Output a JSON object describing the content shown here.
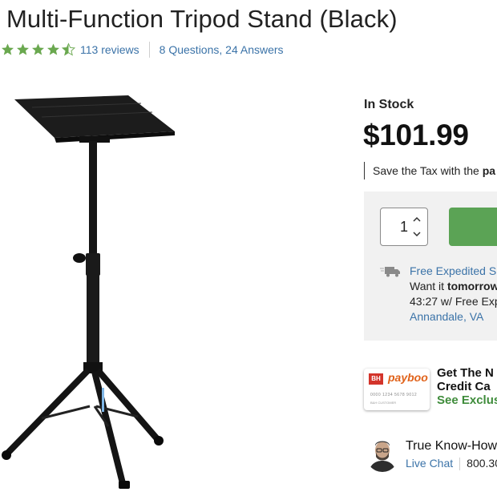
{
  "product": {
    "title": "Multi-Function Tripod Stand (Black)",
    "rating_stars": 4.5,
    "reviews_link": "113 reviews",
    "qa_link": "8 Questions, 24 Answers",
    "image_icon": "tripod-stand-image"
  },
  "purchase": {
    "stock_status": "In Stock",
    "price": "$101.99",
    "tax_text": "Save the Tax with the",
    "tax_brand": "pa",
    "quantity": "1",
    "add_to_cart_color": "#5ba355"
  },
  "shipping": {
    "free_expedited": "Free Expedited S",
    "want_it_prefix": "Want it ",
    "want_it_day": "tomorrow",
    "timer_line": "43:27 w/ Free Exp",
    "location": "Annandale, VA"
  },
  "payboo": {
    "card_logo_bh": "BH",
    "card_logo_brand": "payboo",
    "card_number": "0000 1234 5678 9012",
    "card_name": "B&H CUSTOMER",
    "line1": "Get The N",
    "line2": "Credit Ca",
    "line3": "See Exclus"
  },
  "expert": {
    "title": "True Know-How",
    "chat_link": "Live Chat",
    "phone": "800.30"
  },
  "colors": {
    "link": "#3b73a8",
    "star": "#6aa84f",
    "accent_green": "#3f8c3b"
  }
}
